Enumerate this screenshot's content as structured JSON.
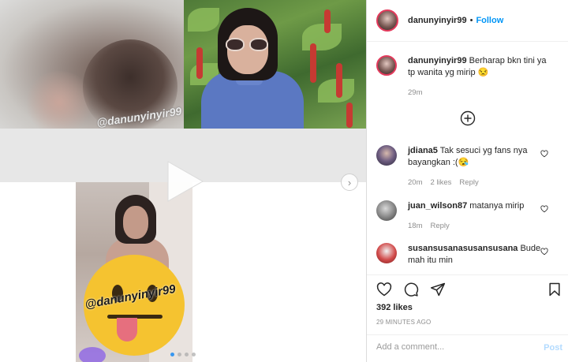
{
  "header": {
    "username": "danunyinyir99",
    "dot": "•",
    "follow_label": "Follow"
  },
  "media": {
    "watermark_top": "@danunyinyir99",
    "watermark_bottom": "@danunyinyir99",
    "next_symbol": "›",
    "carousel_dots": 4,
    "active_dot": 0
  },
  "caption": {
    "username": "danunyinyir99",
    "text": "Berharap bkn tini ya tp wanita yg mirip 😒",
    "time": "29m"
  },
  "comments": [
    {
      "username": "jdiana5",
      "text": "Tak sesuci yg fans nya bayangkan :(😪",
      "time": "20m",
      "likes": "2 likes",
      "reply": "Reply"
    },
    {
      "username": "juan_wilson87",
      "text": "matanya mirip",
      "time": "18m",
      "reply": "Reply"
    },
    {
      "username": "susansusanasusansusana",
      "text": "Bude mah itu min"
    }
  ],
  "footer": {
    "likes": "392 likes",
    "posted": "29 MINUTES AGO",
    "comment_placeholder": "Add a comment...",
    "post_label": "Post"
  },
  "colors": {
    "accent": "#0095f6",
    "post_disabled": "#b3dbff",
    "muted": "#8e8e8e",
    "active_dot": "#3897f0"
  },
  "icons": [
    "add-circle-icon",
    "heart-icon",
    "comment-icon",
    "share-icon",
    "bookmark-icon",
    "play-icon",
    "chevron-right-icon"
  ]
}
